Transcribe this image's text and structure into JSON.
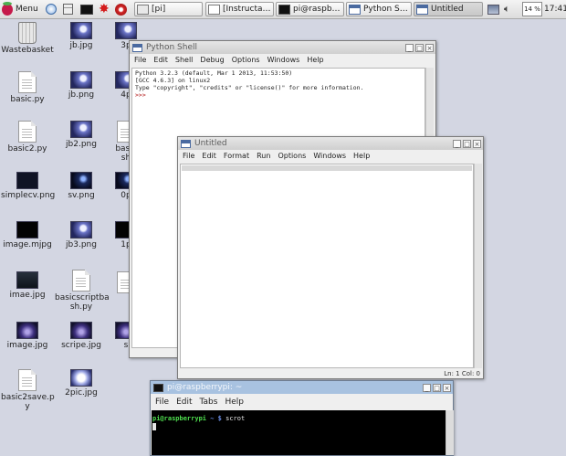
{
  "taskbar": {
    "menu_label": "Menu",
    "tasks": [
      {
        "label": "[pi]",
        "icon": "folder-icon"
      },
      {
        "label": "[Instructable E...",
        "icon": "browser-icon"
      },
      {
        "label": "pi@raspberryp...",
        "icon": "terminal-icon"
      },
      {
        "label": "Python Shell",
        "icon": "python-window-icon"
      },
      {
        "label": "Untitled",
        "icon": "python-window-icon"
      }
    ],
    "cpu": "14 %",
    "clock": "17:41"
  },
  "desktop_icons": [
    {
      "label": "Wastebasket",
      "kind": "trash"
    },
    {
      "label": "basic.py",
      "kind": "doc"
    },
    {
      "label": "basic2.py",
      "kind": "doc"
    },
    {
      "label": "simplecv.png",
      "kind": "dark"
    },
    {
      "label": "image.mjpg",
      "kind": "black"
    },
    {
      "label": "imae.jpg",
      "kind": "teal"
    },
    {
      "label": "image.jpg",
      "kind": "violet"
    },
    {
      "label": "basic2save.p",
      "label2": "y",
      "kind": "doc"
    },
    {
      "label": "jb.jpg",
      "kind": "blue"
    },
    {
      "label": "jb.png",
      "kind": "blue"
    },
    {
      "label": "jb2.png",
      "kind": "blue"
    },
    {
      "label": "sv.png",
      "kind": "darkblue"
    },
    {
      "label": "jb3.png",
      "kind": "blue"
    },
    {
      "label": "basicscriptba",
      "label2": "sh.py",
      "kind": "doc"
    },
    {
      "label": "scripe.jpg",
      "kind": "violet"
    },
    {
      "label": "2pic.jpg",
      "kind": "white"
    },
    {
      "label": "3p",
      "kind": "blue"
    },
    {
      "label": "4p",
      "kind": "blue"
    },
    {
      "label": "basic",
      "label2": "sh",
      "kind": "doc"
    },
    {
      "label": "0p",
      "kind": "darkblue"
    },
    {
      "label": "1p",
      "kind": "black"
    },
    {
      "label": "",
      "kind": "doc"
    },
    {
      "label": "s",
      "kind": "violet"
    }
  ],
  "python_shell": {
    "title": "Python Shell",
    "menu": [
      "File",
      "Edit",
      "Shell",
      "Debug",
      "Options",
      "Windows",
      "Help"
    ],
    "lines": [
      "Python 3.2.3 (default, Mar  1 2013, 11:53:50)",
      "[GCC 4.6.3] on linux2",
      "Type \"copyright\", \"credits\" or \"license()\" for more information."
    ],
    "prompt": ">>>"
  },
  "untitled": {
    "title": "Untitled",
    "menu": [
      "File",
      "Edit",
      "Format",
      "Run",
      "Options",
      "Windows",
      "Help"
    ],
    "status": "Ln: 1 Col: 0"
  },
  "terminal": {
    "title": "pi@raspberrypi: ~",
    "menu": [
      "File",
      "Edit",
      "Tabs",
      "Help"
    ],
    "prompt_user": "pi@raspberrypi",
    "prompt_path": "~ $",
    "command": "scrot"
  },
  "colors": {
    "desktop": "#d3d6e2",
    "terminal_title": "#a8c2e0",
    "terminal_bg": "#000000",
    "prompt_green": "#4fe04f",
    "python_prompt": "#b01010"
  }
}
